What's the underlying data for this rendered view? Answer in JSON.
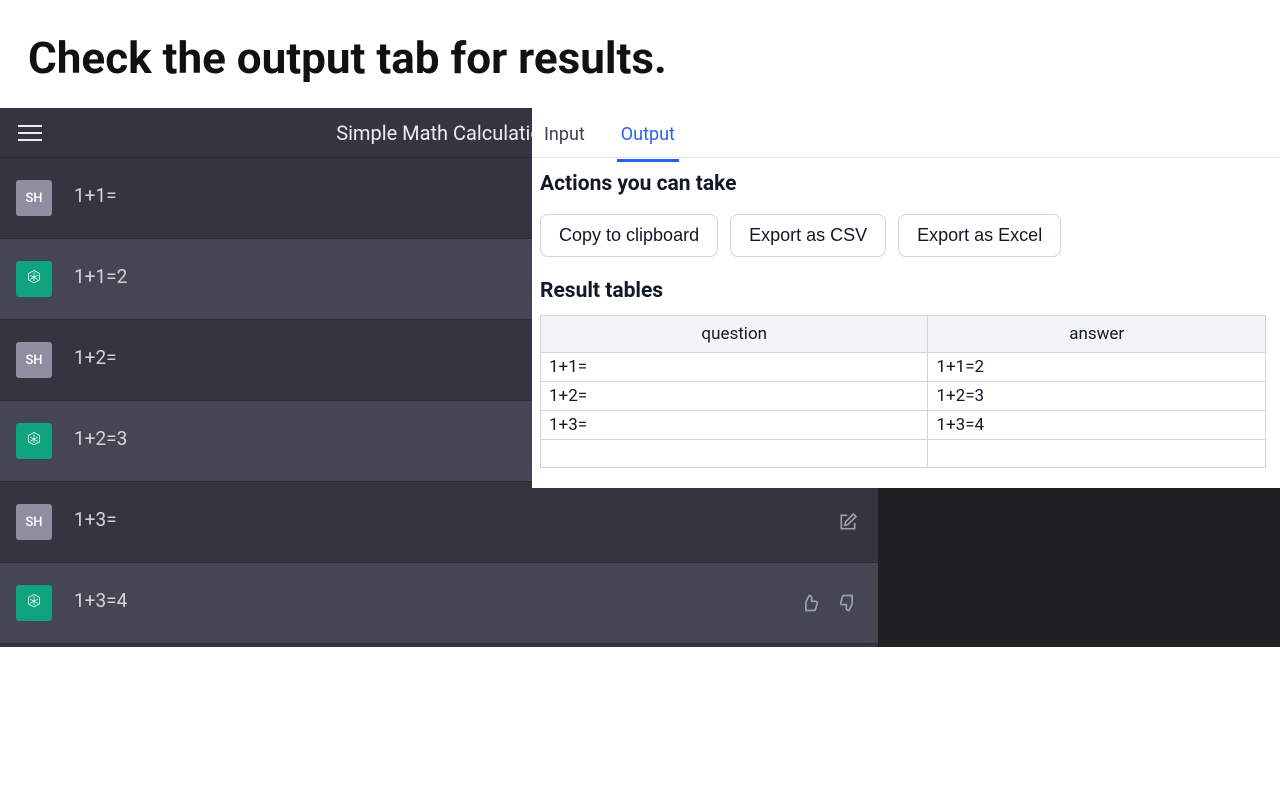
{
  "page_heading": "Check the output tab for results.",
  "chat": {
    "title": "Simple Math Calculatio",
    "user_avatar_label": "SH",
    "messages": [
      {
        "role": "user",
        "text": "1+1="
      },
      {
        "role": "assistant",
        "text": "1+1=2"
      },
      {
        "role": "user",
        "text": "1+2="
      },
      {
        "role": "assistant",
        "text": "1+2=3"
      },
      {
        "role": "user",
        "text": "1+3=",
        "show_edit": true
      },
      {
        "role": "assistant",
        "text": "1+3=4",
        "show_feedback": true
      }
    ]
  },
  "output_panel": {
    "tabs": {
      "input": "Input",
      "output": "Output"
    },
    "actions_heading": "Actions you can take",
    "buttons": {
      "copy": "Copy to clipboard",
      "csv": "Export as CSV",
      "excel": "Export as Excel"
    },
    "results_heading": "Result tables",
    "table": {
      "columns": [
        "question",
        "answer"
      ],
      "rows": [
        {
          "question": "1+1=",
          "answer": "1+1=2"
        },
        {
          "question": "1+2=",
          "answer": "1+2=3"
        },
        {
          "question": "1+3=",
          "answer": "1+3=4"
        }
      ]
    }
  }
}
